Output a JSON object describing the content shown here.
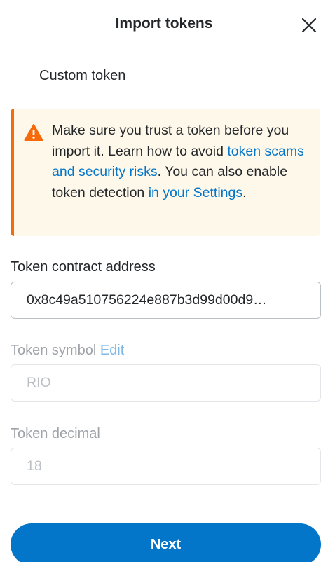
{
  "header": {
    "title": "Import tokens",
    "close_icon": "close-icon"
  },
  "tabs": {
    "active": "Custom token"
  },
  "warning": {
    "icon": "warning-triangle-icon",
    "text_part1": "Make sure you trust a token before you import it. Learn how to avoid ",
    "link_scams": "token scams and security risks",
    "text_part2": ". You can also enable token detection ",
    "link_settings": "in your Settings",
    "text_part3": ".",
    "accent_color": "#f66a0a",
    "background_color": "#fef8ea"
  },
  "form": {
    "address_label": "Token contract address",
    "address_value": "0x8c49a510756224e887b3d99d00d9…",
    "symbol_label": "Token symbol",
    "symbol_edit": "Edit",
    "symbol_value": "RIO",
    "decimal_label": "Token decimal",
    "decimal_value": "18"
  },
  "actions": {
    "next_label": "Next",
    "primary_color": "#0376c9"
  }
}
